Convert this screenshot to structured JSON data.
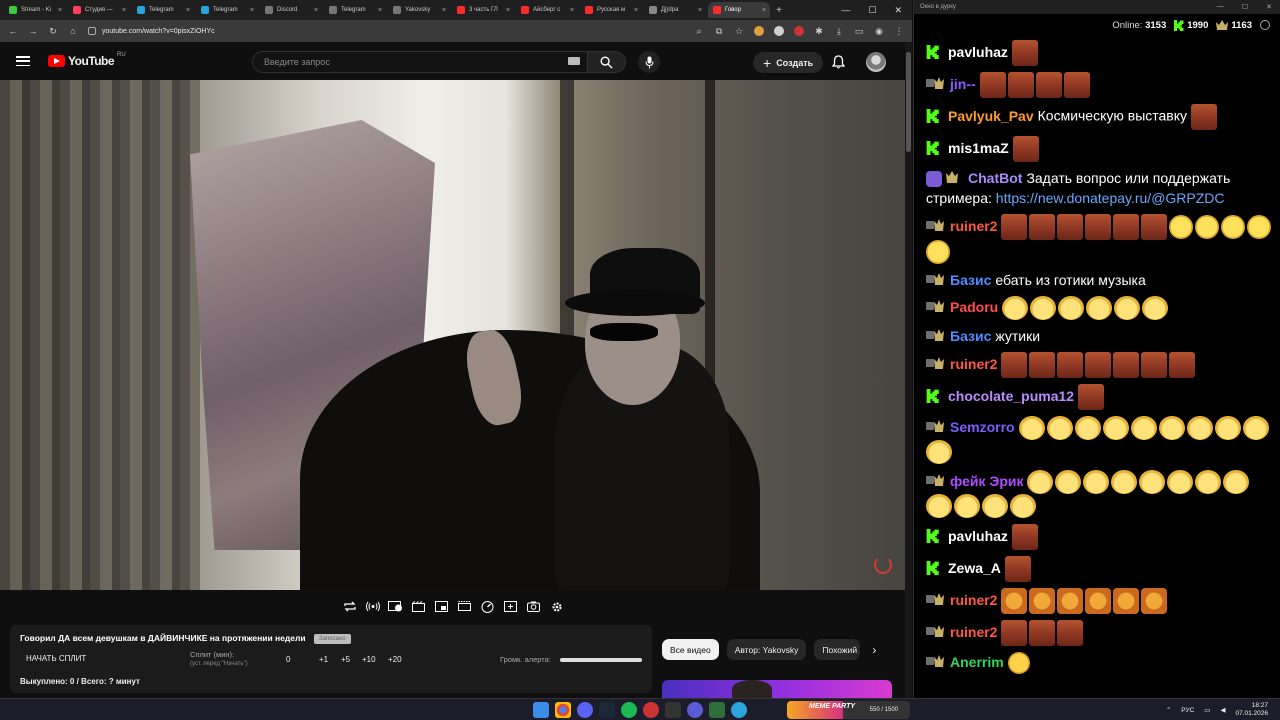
{
  "browser": {
    "tabs": [
      {
        "label": "Stream - Ki",
        "color": "#3fcb3f",
        "active": false
      },
      {
        "label": "Студия —",
        "color": "#ff4060",
        "active": false
      },
      {
        "label": "Telegram",
        "color": "#2aa3de",
        "active": false
      },
      {
        "label": "Telegram",
        "color": "#2aa3de",
        "active": false
      },
      {
        "label": "Discord",
        "color": "#777777",
        "active": false
      },
      {
        "label": "Telegram",
        "color": "#777777",
        "active": false
      },
      {
        "label": "Yakovsky",
        "color": "#777777",
        "active": false
      },
      {
        "label": "3 часть ГЛ",
        "color": "#ff2a2a",
        "active": false
      },
      {
        "label": "Айсберг с",
        "color": "#ff2a2a",
        "active": false
      },
      {
        "label": "Русская м",
        "color": "#ff2a2a",
        "active": false
      },
      {
        "label": "Дj)dpa",
        "color": "#888888",
        "active": false
      },
      {
        "label": "Говор",
        "color": "#ff2a2a",
        "active": true
      }
    ],
    "new_tab": "+",
    "window_controls": {
      "minimize": "—",
      "maximize": "☐",
      "close": "✕"
    },
    "url": "youtube.com/watch?v=0pisxZiOHYc"
  },
  "youtube": {
    "logo_text": "YouTube",
    "region": "RU",
    "search_placeholder": "Введите запрос",
    "create_label": "Создать"
  },
  "video": {
    "title": "Говорил ДА всем девушкам в ДАЙВИНЧИКЕ на протяжении недели",
    "badge": "Записано"
  },
  "split_panel": {
    "start_label": "НАЧАТЬ СПЛИТ",
    "split_label": "Сплит (мин):",
    "split_hint": "(уст. перед \"Начать\")",
    "split_value": "0",
    "increments": [
      "+1",
      "+5",
      "+10",
      "+20"
    ],
    "alert_label": "Громк. алерта:",
    "alert_volume": 1.0,
    "bought": "Выкуплено: 0 / Всего: ? минут"
  },
  "chips": [
    "Все видео",
    "Автор: Yakovsky",
    "Похожий к"
  ],
  "chat": {
    "window_title": "Окно в дурку",
    "online_label": "Online:",
    "online_count": "3153",
    "kick_count": "1990",
    "shield_count": "1163",
    "messages": [
      {
        "badge": "kick",
        "nick": "pavluhaz",
        "color": "#ffffff",
        "text": "",
        "emotes": [
          "brown"
        ]
      },
      {
        "badge": "shield",
        "nick": "jin--",
        "color": "#8a5cff",
        "text": "",
        "emotes": [
          "brown",
          "brown",
          "brown",
          "brown"
        ]
      },
      {
        "badge": "kick",
        "nick": "Pavlyuk_Pav",
        "color": "#ff9a2e",
        "text": "Космическую выставку",
        "emotes": [
          "brown"
        ]
      },
      {
        "badge": "kick",
        "nick": "mis1maZ",
        "color": "#ffffff",
        "text": "",
        "emotes": [
          "brown"
        ]
      },
      {
        "badge": "bot",
        "nick": "ChatBot",
        "color": "#a78bfa",
        "text": "Задать вопрос или поддержать стримера:",
        "link": "https://new.donatepay.ru/@GRPZDC",
        "emotes": []
      },
      {
        "badge": "shield",
        "nick": "ruiner2",
        "color": "#ff5a3c",
        "text": "",
        "emotes": [
          "brown",
          "brown",
          "brown",
          "brown",
          "brown",
          "brown",
          "wink",
          "wink",
          "wink",
          "wink",
          "wink"
        ]
      },
      {
        "badge": "shield",
        "nick": "Базис",
        "color": "#4f8cff",
        "text": "ебать из готики музыка",
        "emotes": []
      },
      {
        "badge": "shield",
        "nick": "Padoru",
        "color": "#ff4d4d",
        "text": "",
        "emotes": [
          "laugh",
          "laugh",
          "laugh",
          "laugh",
          "laugh",
          "laugh"
        ]
      },
      {
        "badge": "shield",
        "nick": "Базис",
        "color": "#4f8cff",
        "text": "жутики",
        "emotes": []
      },
      {
        "badge": "shield",
        "nick": "ruiner2",
        "color": "#ff5a3c",
        "text": "",
        "emotes": [
          "brown",
          "brown",
          "brown",
          "brown",
          "brown",
          "brown",
          "brown"
        ]
      },
      {
        "badge": "kick",
        "nick": "chocolate_puma12",
        "color": "#b98cff",
        "text": "",
        "emotes": [
          "brown"
        ]
      },
      {
        "badge": "shield",
        "nick": "Semzorro",
        "color": "#7a5cff",
        "text": "",
        "emotes": [
          "laugh",
          "laugh",
          "laugh",
          "laugh",
          "laugh",
          "laugh",
          "laugh",
          "laugh",
          "laugh",
          "laugh"
        ]
      },
      {
        "badge": "shield",
        "nick": "фейк Эрик",
        "color": "#b04cff",
        "text": "",
        "emotes": [
          "laugh",
          "laugh",
          "laugh",
          "laugh",
          "laugh",
          "laugh",
          "laugh",
          "laugh",
          "laugh",
          "laugh",
          "laugh",
          "laugh"
        ]
      },
      {
        "badge": "kick",
        "nick": "pavluhaz",
        "color": "#ffffff",
        "text": "",
        "emotes": [
          "brown"
        ]
      },
      {
        "badge": "kick",
        "nick": "Zewa_A",
        "color": "#ffffff",
        "text": "",
        "emotes": [
          "brown"
        ]
      },
      {
        "badge": "shield",
        "nick": "ruiner2",
        "color": "#ff5a3c",
        "text": "",
        "emotes": [
          "tiger",
          "tiger",
          "tiger",
          "tiger",
          "tiger",
          "tiger"
        ]
      },
      {
        "badge": "shield",
        "nick": "ruiner2",
        "color": "#ff5a3c",
        "text": "",
        "emotes": [
          "brown",
          "brown",
          "brown"
        ]
      },
      {
        "badge": "shield",
        "nick": "Anerrim",
        "color": "#2fd65a",
        "text": "",
        "emotes": [
          "think"
        ]
      }
    ]
  },
  "taskbar": {
    "meme_party_label": "MEME PARTY",
    "meme_party_value": "550 / 1500",
    "lang": "РУС",
    "time": "18:27",
    "date": "07.01.2026"
  }
}
